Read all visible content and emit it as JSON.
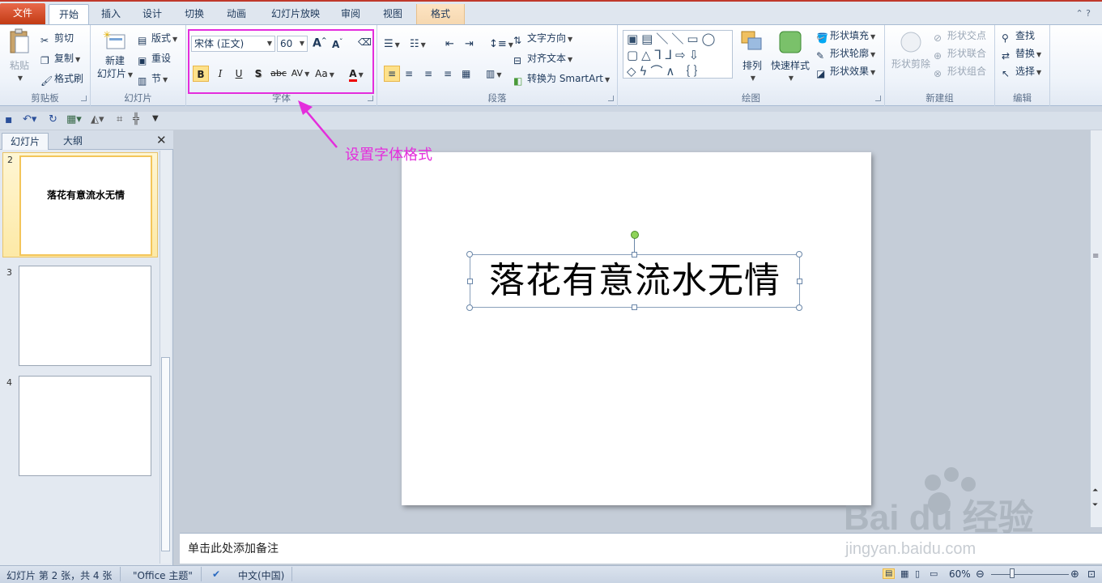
{
  "tabs": [
    "文件",
    "开始",
    "插入",
    "设计",
    "切换",
    "动画",
    "幻灯片放映",
    "审阅",
    "视图",
    "格式"
  ],
  "ribbon": {
    "clipboard": {
      "paste": "粘贴",
      "cut": "剪切",
      "copy": "复制",
      "painter": "格式刷",
      "label": "剪贴板"
    },
    "slides": {
      "new_slide_1": "新建",
      "new_slide_2": "幻灯片",
      "layout": "版式",
      "reset": "重设",
      "section": "节",
      "label": "幻灯片"
    },
    "font": {
      "name": "宋体 (正文)",
      "size": "60",
      "grow": "A",
      "shrink": "A",
      "bold": "B",
      "italic": "I",
      "underline": "U",
      "shadow": "S",
      "strike": "abc",
      "spacing": "AV",
      "case": "Aa",
      "color": "A",
      "label": "字体"
    },
    "paragraph": {
      "direction": "文字方向",
      "align": "对齐文本",
      "smartart": "转换为 SmartArt",
      "label": "段落"
    },
    "drawing": {
      "arrange": "排列",
      "quick": "快速样式",
      "fill": "形状填充",
      "outline": "形状轮廓",
      "effect": "形状效果",
      "label": "绘图"
    },
    "newgroup": {
      "erase": "形状剪除",
      "intersect": "形状交点",
      "union": "形状联合",
      "combine": "形状组合",
      "label": "新建组"
    },
    "edit": {
      "find": "查找",
      "replace": "替换",
      "select": "选择",
      "label": "编辑"
    }
  },
  "panel": {
    "tab_slides": "幻灯片",
    "tab_outline": "大纲",
    "close": "✕",
    "thumbs": [
      {
        "num": "2",
        "text": "落花有意流水无情"
      },
      {
        "num": "3",
        "text": ""
      },
      {
        "num": "4",
        "text": ""
      }
    ]
  },
  "slide": {
    "title": "落花有意流水无情"
  },
  "annotation": "设置字体格式",
  "notes": "单击此处添加备注",
  "status": {
    "slide": "幻灯片 第 2 张，共 4 张",
    "theme": "\"Office 主题\"",
    "lang": "中文(中国)",
    "zoom": "60%"
  },
  "watermark": {
    "brand": "Bai du 经验",
    "url": "jingyan.baidu.com"
  },
  "colors": {
    "accent": "#e42ddc",
    "file_tab": "#d24726",
    "format_tab": "#f6d8b1"
  }
}
